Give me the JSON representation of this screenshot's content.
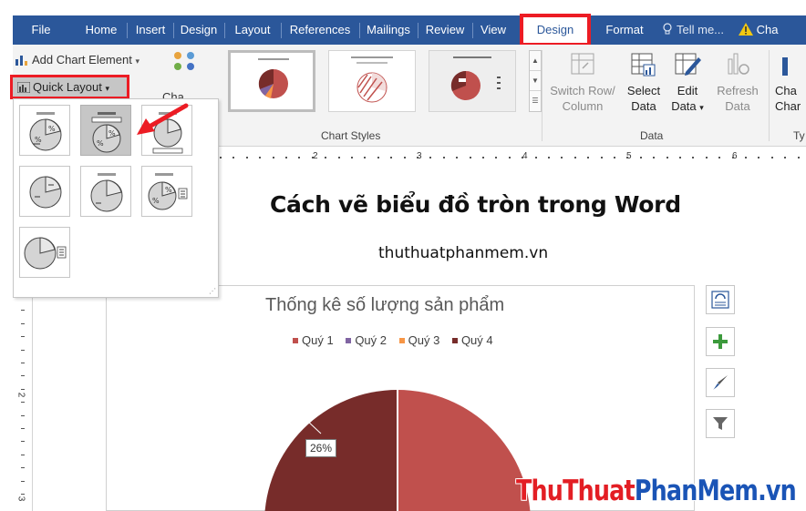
{
  "tabs": {
    "file": "File",
    "home": "Home",
    "insert": "Insert",
    "design": "Design",
    "layout": "Layout",
    "references": "References",
    "mailings": "Mailings",
    "review": "Review",
    "view": "View",
    "chart_design": "Design",
    "format": "Format",
    "tell_me": "Tell me...",
    "share_partial": "Cha"
  },
  "ribbon": {
    "add_chart_element": "Add Chart Element",
    "quick_layout": "Quick Layout",
    "change_colors_partial": "Cha",
    "chart_styles_label": "Chart Styles",
    "switch_row_line1": "Switch Row/",
    "switch_row_line2": "Column",
    "select_data_line1": "Select",
    "select_data_line2": "Data",
    "edit_data_line1": "Edit",
    "edit_data_line2": "Data",
    "refresh_data_line1": "Refresh",
    "refresh_data_line2": "Data",
    "data_group_label": "Data",
    "change_type_line1": "Cha",
    "change_type_line2": "Char",
    "type_group_partial": "Ty"
  },
  "ruler": {
    "numbers": [
      "2",
      "3",
      "4",
      "5",
      "6"
    ]
  },
  "vruler": {
    "numbers": [
      "2",
      "3"
    ]
  },
  "document": {
    "title": "Cách vẽ biểu đồ tròn trong Word",
    "subtitle": "thuthuatphanmem.vn"
  },
  "chart_data": {
    "type": "pie",
    "title": "Thống kê số lượng sản phẩm",
    "categories": [
      "Quý 1",
      "Quý 2",
      "Quý 3",
      "Quý 4"
    ],
    "colors": [
      "#c0504d",
      "#8064a2",
      "#f79646",
      "#772c2a"
    ],
    "data_labels": [
      "",
      "",
      "",
      "26%"
    ],
    "visible_values_percent": [
      null,
      null,
      null,
      26
    ],
    "legend_position": "top"
  },
  "watermark": {
    "part1": "ThuThuat",
    "part2": "PhanMem",
    "part3": ".vn"
  },
  "colors": {
    "ribbon_blue": "#2b579a",
    "highlight_red": "#ec1c24",
    "ribbon_bg": "#f3f3f3"
  }
}
